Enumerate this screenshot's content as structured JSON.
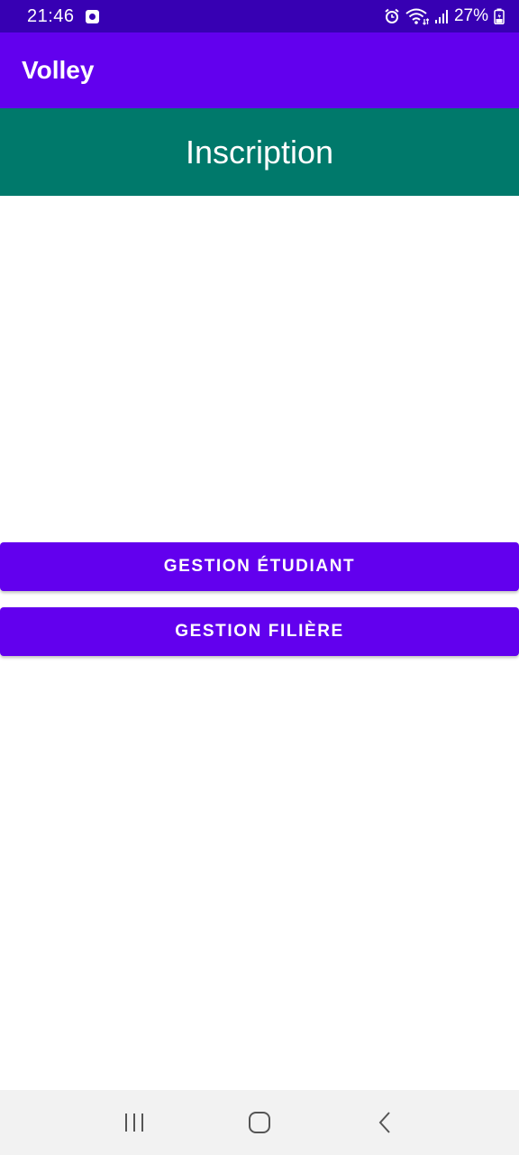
{
  "status_bar": {
    "time": "21:46",
    "battery_percent": "27%",
    "icons": [
      "notification-icon",
      "alarm-icon",
      "wifi-icon",
      "signal-icon",
      "battery-icon"
    ]
  },
  "app_bar": {
    "title": "Volley"
  },
  "header": {
    "title": "Inscription"
  },
  "buttons": {
    "gestion_etudiant": "GESTION ÉTUDIANT",
    "gestion_filiere": "GESTION FILIÈRE"
  },
  "nav_bar": {
    "icons": [
      "recents-icon",
      "home-icon",
      "back-icon"
    ]
  },
  "colors": {
    "status_bar": "#3700b3",
    "primary": "#6200ee",
    "header": "#00796b",
    "nav_bar": "#f2f2f2"
  }
}
